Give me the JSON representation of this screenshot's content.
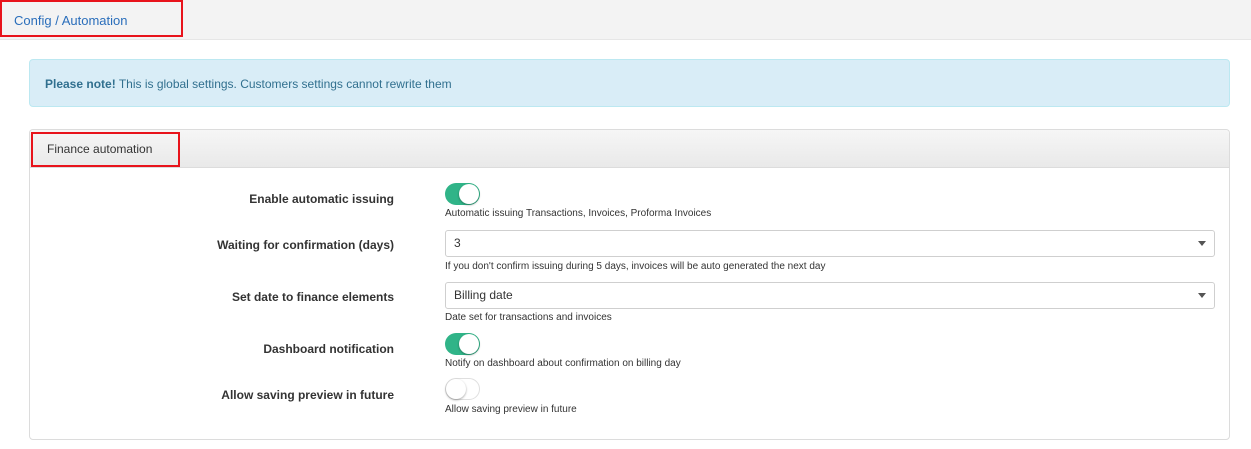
{
  "breadcrumb": {
    "text": "Config / Automation"
  },
  "alert": {
    "strong": "Please note!",
    "text": " This is global settings. Customers settings cannot rewrite them"
  },
  "panel": {
    "title": "Finance automation",
    "fields": {
      "enable_issuing": {
        "label": "Enable automatic issuing",
        "enabled": true,
        "help": "Automatic issuing Transactions, Invoices, Proforma Invoices"
      },
      "waiting_days": {
        "label": "Waiting for confirmation (days)",
        "value": "3",
        "help": "If you don't confirm issuing during 5 days, invoices will be auto generated the next day"
      },
      "set_date": {
        "label": "Set date to finance elements",
        "value": "Billing date",
        "help": "Date set for transactions and invoices"
      },
      "dashboard_notification": {
        "label": "Dashboard notification",
        "enabled": true,
        "help": "Notify on dashboard about confirmation on billing day"
      },
      "allow_preview": {
        "label": "Allow saving preview in future",
        "enabled": false,
        "help": "Allow saving preview in future"
      }
    }
  },
  "colors": {
    "accent": "#30b488",
    "link": "#2a6ebb",
    "highlight": "#e8131b",
    "alert_bg": "#d9edf7"
  }
}
